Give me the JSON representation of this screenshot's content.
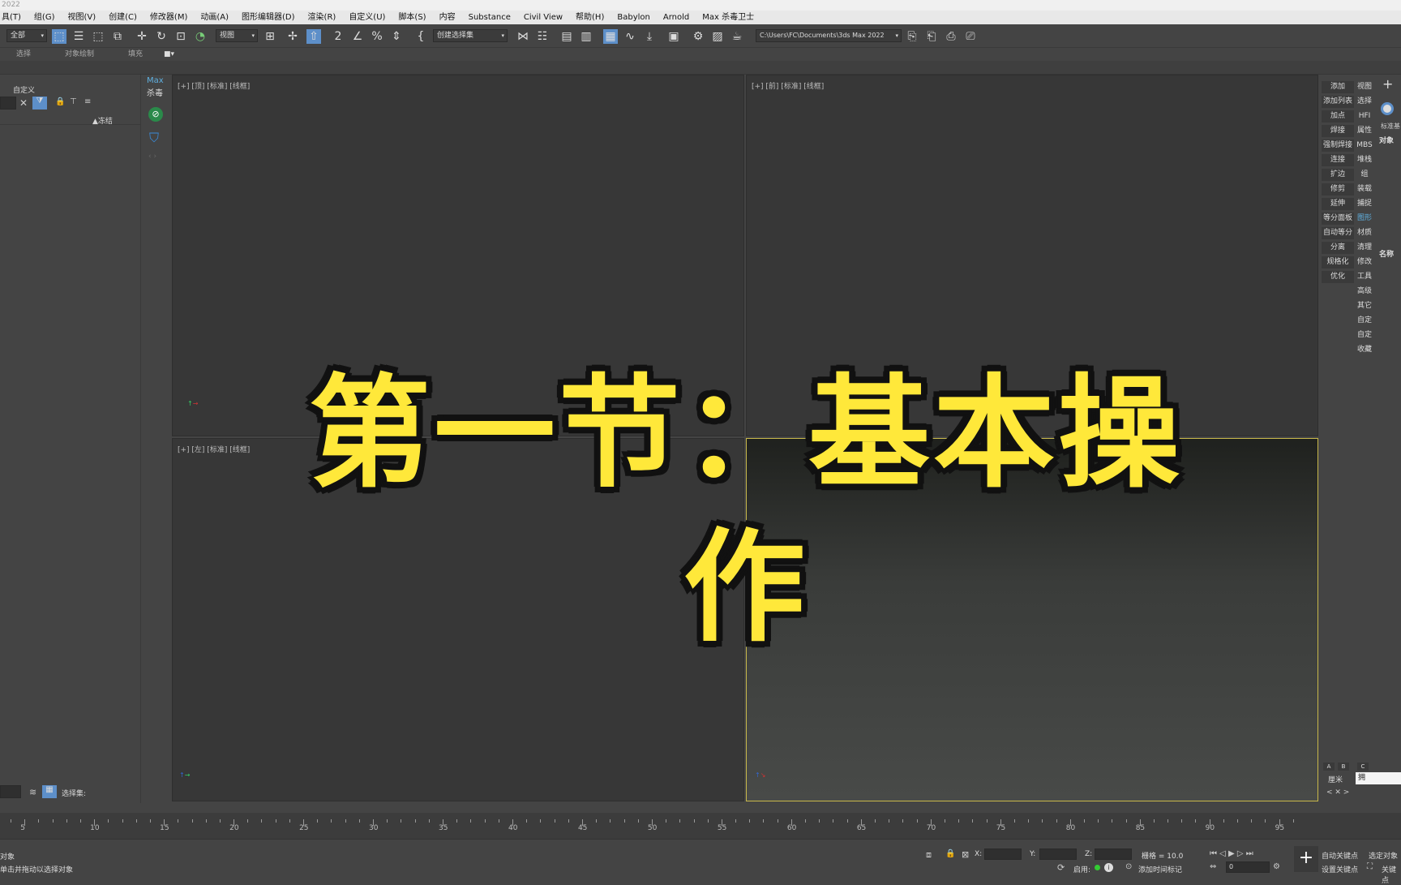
{
  "window": {
    "title": "2022"
  },
  "menu": [
    "具(T)",
    "组(G)",
    "视图(V)",
    "创建(C)",
    "修改器(M)",
    "动画(A)",
    "图形编辑器(D)",
    "渲染(R)",
    "自定义(U)",
    "脚本(S)",
    "内容",
    "Substance",
    "Civil View",
    "帮助(H)",
    "Babylon",
    "Arnold",
    "Max 杀毒卫士"
  ],
  "toolbar": {
    "filter_value": "全部",
    "refcoord_value": "视图",
    "selset_value": "创建选择集",
    "path_value": "C:\\Users\\FC\\Documents\\3ds Max 2022"
  },
  "ribbon": {
    "tabs": [
      "选择",
      "对象绘制",
      "填充"
    ]
  },
  "scene": {
    "title": "自定义",
    "freeze_col": "▲冻结",
    "selset_label": "选择集:"
  },
  "sidestrip": {
    "max_label": "Max",
    "virus_label": "杀毒"
  },
  "viewports": {
    "top": "[+] [顶] [标准] [线框]",
    "front": "[+] [前] [标准] [线框]",
    "left": "[+] [左] [标准] [线框]",
    "persp": ""
  },
  "overlay": {
    "text": "第一节：基本操作",
    "color": "#ffe83a"
  },
  "cmd_left": [
    "添加",
    "添加列表",
    "加点",
    "焊接",
    "强制焊接",
    "连接",
    "扩边",
    "修剪",
    "延伸",
    "等分面板",
    "自动等分",
    "分离",
    "规格化",
    "优化"
  ],
  "cmd_right": [
    "视图",
    "选择",
    "HFI",
    "属性",
    "MBS",
    "堆栈",
    "组",
    "装载",
    "捕捉",
    "图形",
    "材质",
    "清理",
    "修改",
    "工具",
    "高级",
    "其它",
    "自定",
    "自定",
    "收藏"
  ],
  "far_right": {
    "plus": "+",
    "std": "标准基",
    "sec1": "对象",
    "sec2": "名称"
  },
  "abc": [
    "A",
    "B",
    "C"
  ],
  "unit": {
    "label": "厘米",
    "value": "拥"
  },
  "timeline": {
    "ticks": [
      "5",
      "10",
      "15",
      "20",
      "25",
      "30",
      "35",
      "40",
      "45",
      "50",
      "55",
      "60",
      "65",
      "70",
      "75",
      "80",
      "85",
      "90",
      "95"
    ]
  },
  "status": {
    "line1": "对象",
    "line2": "单击并拖动以选择对象",
    "x_label": "X:",
    "y_label": "Y:",
    "z_label": "Z:",
    "grid": "栅格 = 10.0",
    "enable": "启用:",
    "add_time_tag": "添加时间标记",
    "autokey": "自动关键点",
    "setkey": "设置关键点",
    "selected": "选定对象",
    "keyfilter": "关键点",
    "frame": "0"
  }
}
